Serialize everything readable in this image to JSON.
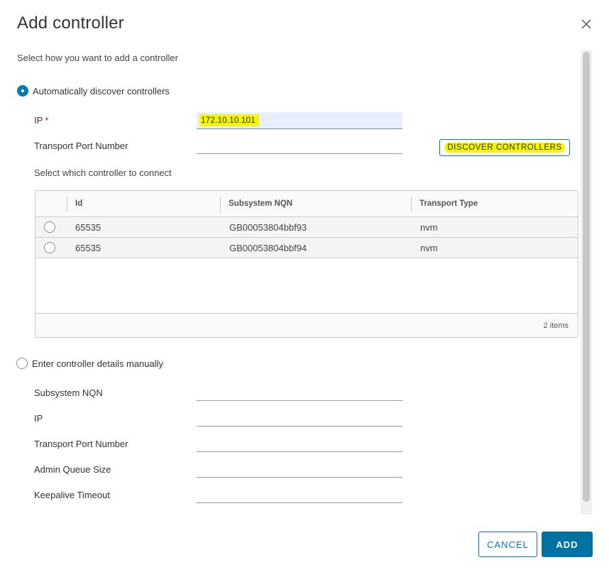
{
  "dialog": {
    "title": "Add controller",
    "instruction": "Select how you want to add a controller"
  },
  "auto_discover": {
    "option_label": "Automatically discover controllers",
    "selected": true,
    "ip_label": "IP",
    "ip_required_marker": "*",
    "ip_value": "172.10.10.101",
    "port_label": "Transport Port Number",
    "port_value": "",
    "discover_button": "DISCOVER CONTROLLERS",
    "select_label": "Select which controller to connect"
  },
  "controllers_table": {
    "columns": [
      "Id",
      "Subsystem NQN",
      "Transport Type"
    ],
    "rows": [
      {
        "id": "65535",
        "nqn": "GB00053804bbf93",
        "transport": "nvm"
      },
      {
        "id": "65535",
        "nqn": "GB00053804bbf94",
        "transport": "nvm"
      }
    ],
    "footer_count": "2 items"
  },
  "manual": {
    "option_label": "Enter controller details manually",
    "selected": false,
    "fields": [
      {
        "label": "Subsystem NQN",
        "value": ""
      },
      {
        "label": "IP",
        "value": ""
      },
      {
        "label": "Transport Port Number",
        "value": ""
      },
      {
        "label": "Admin Queue Size",
        "value": ""
      },
      {
        "label": "Keepalive Timeout",
        "value": ""
      }
    ]
  },
  "actions": {
    "cancel": "CANCEL",
    "add": "ADD"
  },
  "colors": {
    "accent": "#0079b8",
    "primary_button": "#0072a3",
    "highlight": "#f6f600",
    "required": "#c92100"
  },
  "icons": {
    "close": "close-icon"
  }
}
